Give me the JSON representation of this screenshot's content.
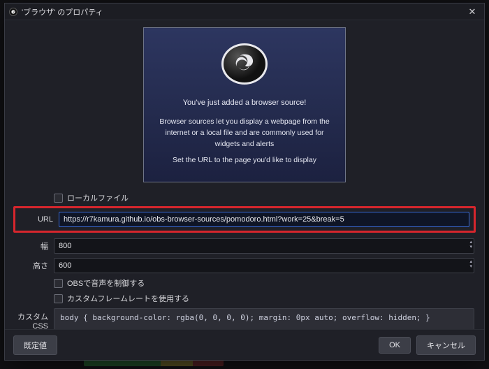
{
  "window": {
    "title": "'ブラウザ' のプロパティ"
  },
  "hero": {
    "line1": "You've just added a browser source!",
    "line2": "Browser sources let you display a webpage from the internet or a local file and are commonly used for widgets and alerts",
    "line3": "Set the URL to the page you'd like to display"
  },
  "form": {
    "local_file_label": "ローカルファイル",
    "url_label": "URL",
    "url_value": "https://r7kamura.github.io/obs-browser-sources/pomodoro.html?work=25&break=5",
    "width_label": "幅",
    "width_value": "800",
    "height_label": "高さ",
    "height_value": "600",
    "control_audio_label": "OBSで音声を制御する",
    "custom_fps_label": "カスタムフレームレートを使用する",
    "custom_css_label": "カスタム CSS",
    "custom_css_value": "body { background-color: rgba(0, 0, 0, 0); margin: 0px auto; overflow: hidden; }"
  },
  "footer": {
    "defaults_label": "既定値",
    "ok_label": "OK",
    "cancel_label": "キャンセル"
  }
}
